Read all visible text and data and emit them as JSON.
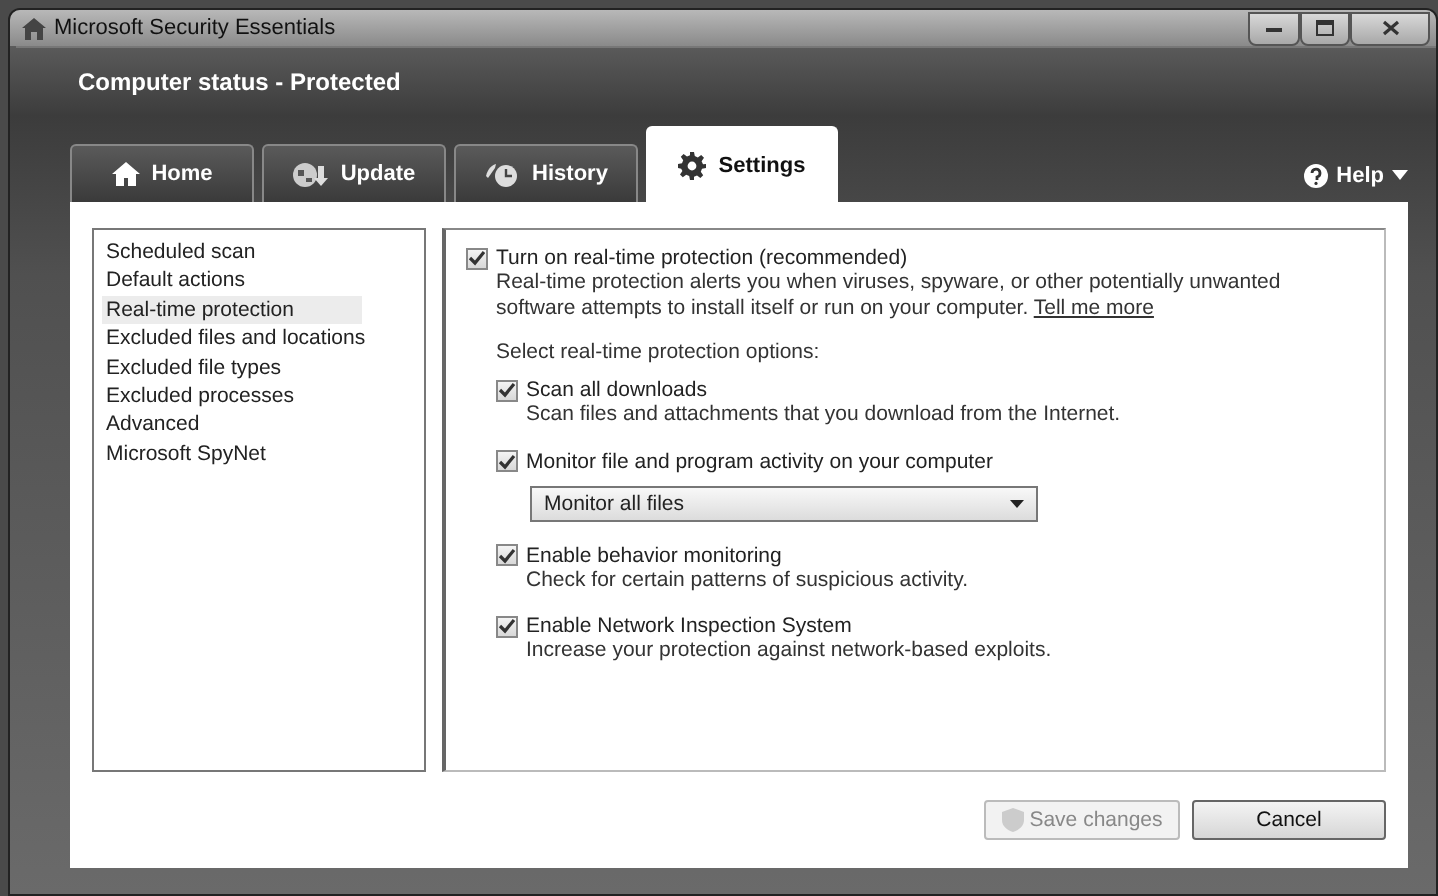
{
  "window": {
    "title": "Microsoft Security Essentials"
  },
  "status": "Computer status - Protected",
  "tabs": [
    {
      "label": "Home",
      "kind": "home",
      "selected": false
    },
    {
      "label": "Update",
      "kind": "update",
      "selected": false
    },
    {
      "label": "History",
      "kind": "history",
      "selected": false
    },
    {
      "label": "Settings",
      "kind": "settings",
      "selected": true
    }
  ],
  "help": {
    "label": "Help"
  },
  "sidebar": {
    "items": [
      {
        "label": "Scheduled scan",
        "selected": false
      },
      {
        "label": "Default actions",
        "selected": false
      },
      {
        "label": "Real-time protection",
        "selected": true
      },
      {
        "label": "Excluded files and locations",
        "selected": false
      },
      {
        "label": "Excluded file types",
        "selected": false
      },
      {
        "label": "Excluded processes",
        "selected": false
      },
      {
        "label": "Advanced",
        "selected": false
      },
      {
        "label": "Microsoft SpyNet",
        "selected": false
      }
    ]
  },
  "main": {
    "master": {
      "label": "Turn on real-time protection (recommended)",
      "checked": true,
      "description": "Real-time protection alerts you when viruses, spyware, or other potentially unwanted software attempts to install itself or run on your computer.",
      "link": "Tell me more"
    },
    "section_label": "Select real-time protection options:",
    "options": [
      {
        "label": "Scan all downloads",
        "checked": true,
        "description": "Scan files and attachments that you download from the Internet."
      },
      {
        "label": "Monitor file and program activity on your computer",
        "checked": true,
        "dropdown": "Monitor all files"
      },
      {
        "label": "Enable behavior monitoring",
        "checked": true,
        "description": "Check for certain patterns of suspicious activity."
      },
      {
        "label": "Enable Network Inspection System",
        "checked": true,
        "description": "Increase your protection against network-based exploits."
      }
    ]
  },
  "buttons": [
    {
      "label": "Save changes",
      "kind": "save",
      "disabled": true
    },
    {
      "label": "Cancel",
      "kind": "cancel",
      "disabled": false
    }
  ]
}
